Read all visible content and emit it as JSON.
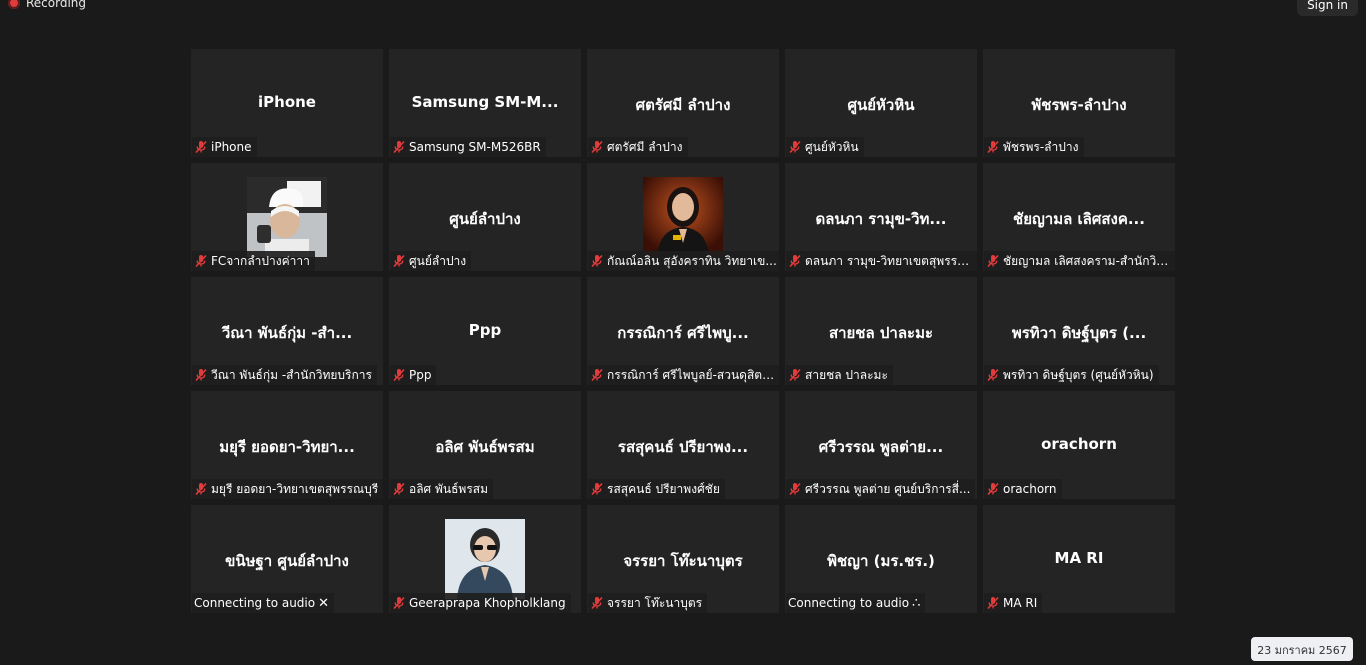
{
  "topbar": {
    "recording_label": "Recording",
    "signin_label": "Sign in"
  },
  "tiles": [
    {
      "name": "iPhone",
      "label": "iPhone",
      "muted": true
    },
    {
      "name": "Samsung  SM-M...",
      "label": "Samsung SM-M526BR",
      "muted": true
    },
    {
      "name": "ศตรัศมี ลำปาง",
      "label": "ศตรัศมี ลำปาง",
      "muted": true
    },
    {
      "name": "ศูนย์หัวหิน",
      "label": "ศูนย์หัวหิน",
      "muted": true
    },
    {
      "name": "พัชรพร-ลำปาง",
      "label": "พัชรพร-ลำปาง",
      "muted": true
    },
    {
      "name": "",
      "label": "FCจากลำปางค่าาา",
      "muted": true,
      "photo": "chef-hat-selfie"
    },
    {
      "name": "ศูนย์ลำปาง",
      "label": "ศูนย์ลำปาง",
      "muted": true
    },
    {
      "name": "",
      "label": "กัณณ์อลิน สุอังคราทิน วิทยาเข...",
      "muted": true,
      "photo": "woman-portrait"
    },
    {
      "name": "ดลนภา รามุข-วิท...",
      "label": "ดลนภา รามุข-วิทยาเขตสุพรรณ...",
      "muted": true
    },
    {
      "name": "ชัยญามล เลิศสงค...",
      "label": "ชัยญามล เลิศสงคราม-สำนักวิท...",
      "muted": true
    },
    {
      "name": "วีณา พันธ์กุ่ม -สำ...",
      "label": "วีณา พันธ์กุ่ม -สำนักวิทยบริการ",
      "muted": true
    },
    {
      "name": "Ppp",
      "label": "Ppp",
      "muted": true
    },
    {
      "name": "กรรณิการ์ ศรีไพบู...",
      "label": "กรรณิการ์ ศรีไพบูลย์-สวนดุสิตโ...",
      "muted": true
    },
    {
      "name": "สายชล ปาละมะ",
      "label": "สายชล ปาละมะ",
      "muted": true
    },
    {
      "name": "พรทิวา ดิษฐ์บุตร (...",
      "label": "พรทิวา ดิษฐ์บุตร (ศูนย์หัวหิน)",
      "muted": true
    },
    {
      "name": "มยุรี ยอดยา-วิทยา...",
      "label": "มยุรี ยอดยา-วิทยาเขตสุพรรณบุรี",
      "muted": true
    },
    {
      "name": "อลิศ พันธ์พรสม",
      "label": "อลิศ พันธ์พรสม",
      "muted": true
    },
    {
      "name": "รสสุคนธ์ ปรียาพง...",
      "label": "รสสุคนธ์ ปรียาพงศ์ชัย",
      "muted": true
    },
    {
      "name": "ศรีวรรณ  พูลต่าย...",
      "label": "ศรีวรรณ  พูลต่าย ศูนย์บริการสี่...",
      "muted": true
    },
    {
      "name": "orachorn",
      "label": "orachorn",
      "muted": true
    },
    {
      "name": "ขนิษฐา ศูนย์ลำปาง",
      "label": "Connecting to audio",
      "muted": false,
      "status_icon": "✕",
      "status_icon_name": "close-icon"
    },
    {
      "name": "",
      "label": "Geeraprapa Khopholklang",
      "muted": true,
      "photo": "man-sunglasses"
    },
    {
      "name": "จรรยา โท๊ะนาบุตร",
      "label": "จรรยา โท๊ะนาบุตร",
      "muted": true
    },
    {
      "name": "พิชญา (มร.ชร.)",
      "label": "Connecting to audio",
      "muted": false,
      "status_icon": "∴",
      "status_icon_name": "connecting-dots-icon"
    },
    {
      "name": "MA RI",
      "label": "MA RI",
      "muted": true
    }
  ],
  "footer": {
    "date": "23 มกราคม 2567"
  },
  "colors": {
    "mute_red": "#e23b3b",
    "tile_bg": "#242424",
    "page_bg": "#1a1a1a"
  }
}
